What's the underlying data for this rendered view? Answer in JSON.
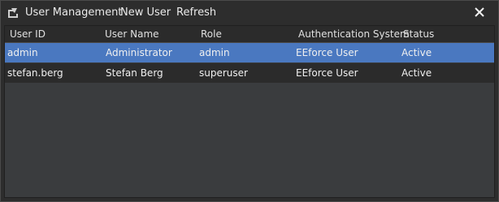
{
  "window": {
    "title": "User Management",
    "menu": {
      "new_user": "New User",
      "refresh": "Refresh"
    }
  },
  "table": {
    "headers": [
      "User ID",
      "User Name",
      "Role",
      "Authentication System",
      "Status"
    ],
    "rows": [
      {
        "user_id": "admin",
        "user_name": "Administrator",
        "role": "admin",
        "auth_system": "EEforce User",
        "status": "Active"
      },
      {
        "user_id": "stefan.berg",
        "user_name": "Stefan Berg",
        "role": "superuser",
        "auth_system": "EEforce User",
        "status": "Active"
      }
    ]
  },
  "colors": {
    "selection": "#4a78c0",
    "background": "#2d2d2d",
    "table_bg": "#3a3c3e"
  },
  "icons": {
    "app": "user-management-icon",
    "close": "close-icon"
  }
}
